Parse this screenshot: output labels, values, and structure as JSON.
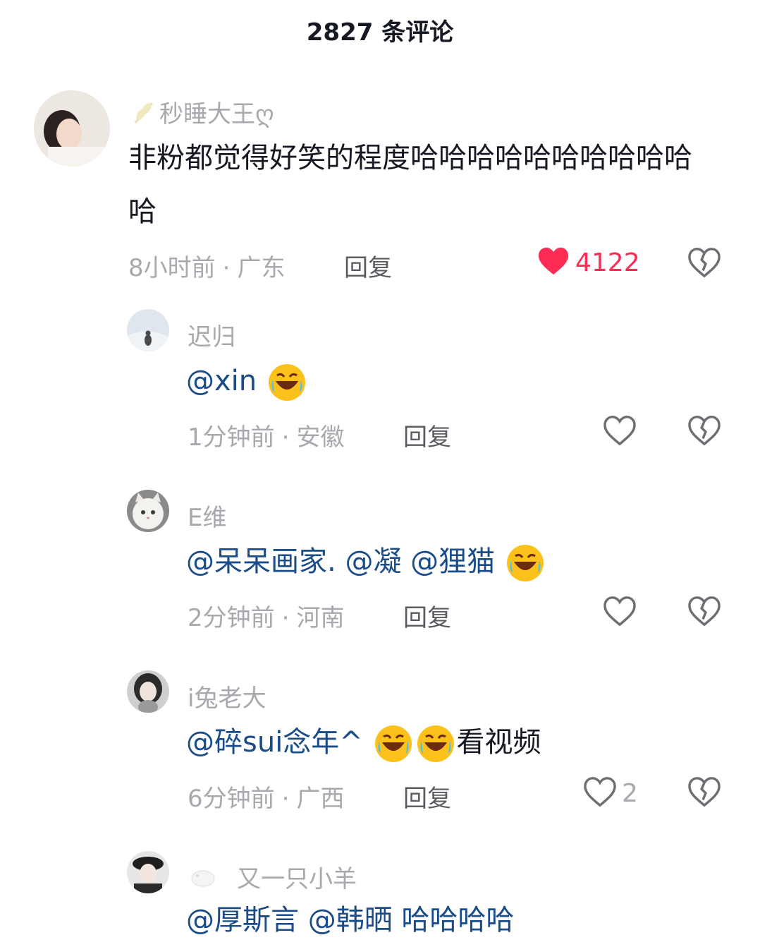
{
  "header": {
    "title": "2827 条评论"
  },
  "comments": [
    {
      "username": "秒睡大王ღ",
      "content": "非粉都觉得好笑的程度哈哈哈哈哈哈哈哈哈哈哈",
      "time": "8小时前",
      "location": "广东",
      "reply": "回复",
      "likes": "4122",
      "liked": true
    }
  ],
  "replies": [
    {
      "username": "迟归",
      "mentions": [
        "@xin"
      ],
      "suffix": "",
      "emoji_count": 1,
      "time": "1分钟前",
      "location": "安徽",
      "reply": "回复",
      "likes": ""
    },
    {
      "username": "E维",
      "mentions": [
        "@呆呆画家.",
        "@凝",
        "@狸猫"
      ],
      "suffix": "",
      "emoji_count": 1,
      "time": "2分钟前",
      "location": "河南",
      "reply": "回复",
      "likes": ""
    },
    {
      "username": "i兔老大",
      "mentions": [
        "@碎sui念年^"
      ],
      "suffix": "看视频",
      "emoji_count": 2,
      "time": "6分钟前",
      "location": "广西",
      "reply": "回复",
      "likes": "2"
    },
    {
      "username": "又一只小羊",
      "partial_content": "@厚斯言 @韩晒 哈哈哈哈"
    }
  ],
  "icons": {
    "like": "heart-icon",
    "dislike": "broken-heart-icon",
    "emoji": "rolling-laughing-emoji"
  },
  "colors": {
    "liked": "#fe2c55",
    "mention": "#1b4c8a",
    "meta": "#a8a9ae"
  }
}
